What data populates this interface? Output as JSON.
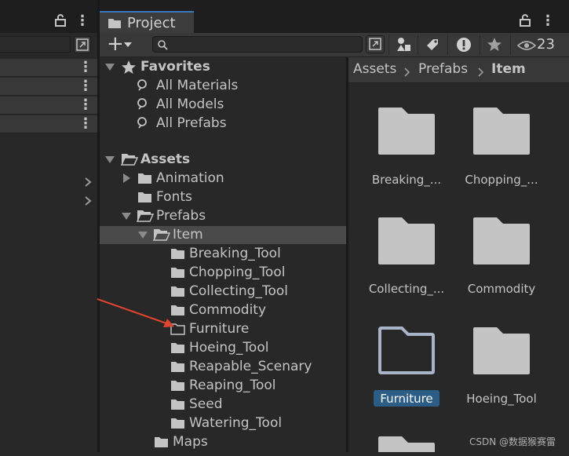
{
  "project_tab": {
    "label": "Project"
  },
  "toolbar": {
    "add_label": "+",
    "visible_count": "23",
    "search_placeholder": ""
  },
  "favorites": {
    "label": "Favorites",
    "items": [
      {
        "label": "All Materials"
      },
      {
        "label": "All Models"
      },
      {
        "label": "All Prefabs"
      }
    ]
  },
  "tree": {
    "assets": "Assets",
    "animation": "Animation",
    "fonts": "Fonts",
    "prefabs": "Prefabs",
    "item": "Item",
    "children": [
      {
        "label": "Breaking_Tool"
      },
      {
        "label": "Chopping_Tool"
      },
      {
        "label": "Collecting_Tool"
      },
      {
        "label": "Commodity"
      },
      {
        "label": "Furniture"
      },
      {
        "label": "Hoeing_Tool"
      },
      {
        "label": "Reapable_Scenary"
      },
      {
        "label": "Reaping_Tool"
      },
      {
        "label": "Seed"
      },
      {
        "label": "Watering_Tool"
      }
    ],
    "maps": "Maps"
  },
  "breadcrumb": [
    "Assets",
    "Prefabs",
    "Item"
  ],
  "grid": [
    {
      "label": "Breaking_..."
    },
    {
      "label": "Chopping_..."
    },
    {
      "label": "Collecting_..."
    },
    {
      "label": "Commodity"
    },
    {
      "label": "Furniture"
    },
    {
      "label": "Hoeing_Tool"
    }
  ],
  "watermark": "CSDN @数据猴赛雷",
  "colors": {
    "background": "#282828",
    "selection": "#2c5d87",
    "tab_accent": "#3a79bb",
    "annotation_arrow": "#e0452e"
  }
}
